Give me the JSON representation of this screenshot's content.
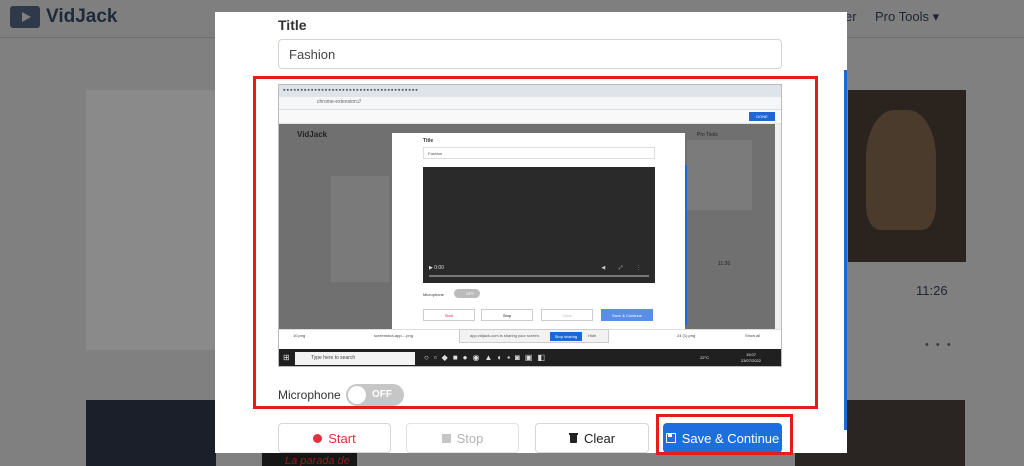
{
  "background": {
    "brand": "VidJack",
    "nav": [
      "er",
      "Pro Tools"
    ],
    "video_duration": "11:26",
    "more_dots": "• • •",
    "thumbnail_caption": "La parada de"
  },
  "modal": {
    "title_label": "Title",
    "title_value": "Fashion",
    "microphone_label": "Microphone",
    "microphone_toggle": "OFF",
    "buttons": {
      "start": "Start",
      "stop": "Stop",
      "clear": "Clear",
      "save": "Save & Continue"
    }
  },
  "nested_screenshot": {
    "url": "chrome-extension://",
    "done": "DONE",
    "brand": "VidJack",
    "nav": "Pro Tools",
    "side_time": "11:26",
    "title_label": "Title",
    "title_value": "Fashion",
    "video_time": "0:00",
    "microphone_label": "Microphone",
    "toggle": "OFF",
    "buttons": [
      "Start",
      "Stop",
      "Clear",
      "Save & Continue"
    ],
    "downloads": [
      "10.png",
      "screenshot-app-...png",
      "24 (1).png",
      "Show all"
    ],
    "share_bar": "app.vidjack.com is sharing your screen.",
    "share_button": "Stop sharing",
    "hide": "Hide",
    "search_placeholder": "Type here to search",
    "temperature": "22°C",
    "clock": [
      "19:07",
      "23/07/2022"
    ]
  },
  "colors": {
    "accent": "#1f6ee0",
    "highlight": "#e51c1c",
    "start_red": "#d9333f"
  }
}
